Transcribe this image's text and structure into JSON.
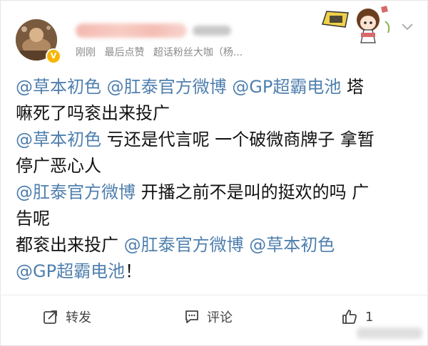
{
  "header": {
    "meta": [
      "刚刚",
      "最后点赞",
      "超话粉丝大咖（杨..."
    ]
  },
  "post": {
    "lines": [
      [
        {
          "t": "@草本初色",
          "m": true
        },
        {
          "t": " ",
          "m": false
        },
        {
          "t": "@肛泰官方微博",
          "m": true
        },
        {
          "t": " ",
          "m": false
        },
        {
          "t": "@GP超霸电池",
          "m": true
        },
        {
          "t": " 塔",
          "m": false
        }
      ],
      [
        {
          "t": "嘛死了吗衮出来投广",
          "m": false
        }
      ],
      [
        {
          "t": "@草本初色",
          "m": true
        },
        {
          "t": " 亏还是代言呢 一个破微商牌子 拿暂",
          "m": false
        }
      ],
      [
        {
          "t": "停广恶心人",
          "m": false
        }
      ],
      [
        {
          "t": "@肛泰官方微博",
          "m": true
        },
        {
          "t": " 开播之前不是叫的挺欢的吗 广",
          "m": false
        }
      ],
      [
        {
          "t": "告呢",
          "m": false
        }
      ],
      [
        {
          "t": "都衮出来投广 ",
          "m": false
        },
        {
          "t": "@肛泰官方微博",
          "m": true
        },
        {
          "t": " ",
          "m": false
        },
        {
          "t": "@草本初色",
          "m": true
        }
      ],
      [
        {
          "t": "@GP超霸电池",
          "m": true
        },
        {
          "t": "！",
          "m": false
        }
      ]
    ]
  },
  "actions": {
    "repost_label": "转发",
    "comment_label": "评论",
    "like_count": "1"
  },
  "colors": {
    "mention": "#4f7fae",
    "meta": "#8a8a8a",
    "text": "#111111",
    "vip_badge": "#f7b500"
  },
  "icons": [
    "chevron-down-icon",
    "repost-icon",
    "comment-icon",
    "like-icon",
    "vip-badge-icon"
  ]
}
